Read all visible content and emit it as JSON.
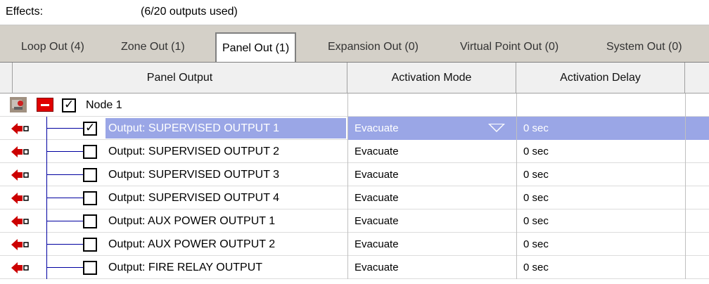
{
  "effects": {
    "label": "Effects:",
    "count": "(6/20 outputs used)"
  },
  "tabs": [
    {
      "label": "Loop Out (4)"
    },
    {
      "label": "Zone Out (1)"
    },
    {
      "label": "Panel Out (1)"
    },
    {
      "label": "Expansion Out (0)"
    },
    {
      "label": "Virtual Point Out (0)"
    },
    {
      "label": "System Out (0)"
    }
  ],
  "active_tab": "Panel Out (1)",
  "columns": [
    "Panel Output",
    "Activation Mode",
    "Activation Delay"
  ],
  "node": {
    "label": "Node 1",
    "checked": true,
    "icon": "node-icon"
  },
  "rows": [
    {
      "name": "Output: SUPERVISED OUTPUT 1",
      "mode": "Evacuate",
      "delay": "0 sec",
      "checked": true,
      "selected": true
    },
    {
      "name": "Output: SUPERVISED OUTPUT 2",
      "mode": "Evacuate",
      "delay": "0 sec",
      "checked": false,
      "selected": false
    },
    {
      "name": "Output: SUPERVISED OUTPUT 3",
      "mode": "Evacuate",
      "delay": "0 sec",
      "checked": false,
      "selected": false
    },
    {
      "name": "Output: SUPERVISED OUTPUT 4",
      "mode": "Evacuate",
      "delay": "0 sec",
      "checked": false,
      "selected": false
    },
    {
      "name": "Output: AUX POWER OUTPUT 1",
      "mode": "Evacuate",
      "delay": "0 sec",
      "checked": false,
      "selected": false
    },
    {
      "name": "Output: AUX POWER OUTPUT 2",
      "mode": "Evacuate",
      "delay": "0 sec",
      "checked": false,
      "selected": false
    },
    {
      "name": "Output: FIRE RELAY OUTPUT",
      "mode": "Evacuate",
      "delay": "0 sec",
      "checked": false,
      "selected": false
    }
  ],
  "colors": {
    "selection": "#9aa6e6",
    "arrow": "#cc0000",
    "tree_line": "#0000a0"
  }
}
